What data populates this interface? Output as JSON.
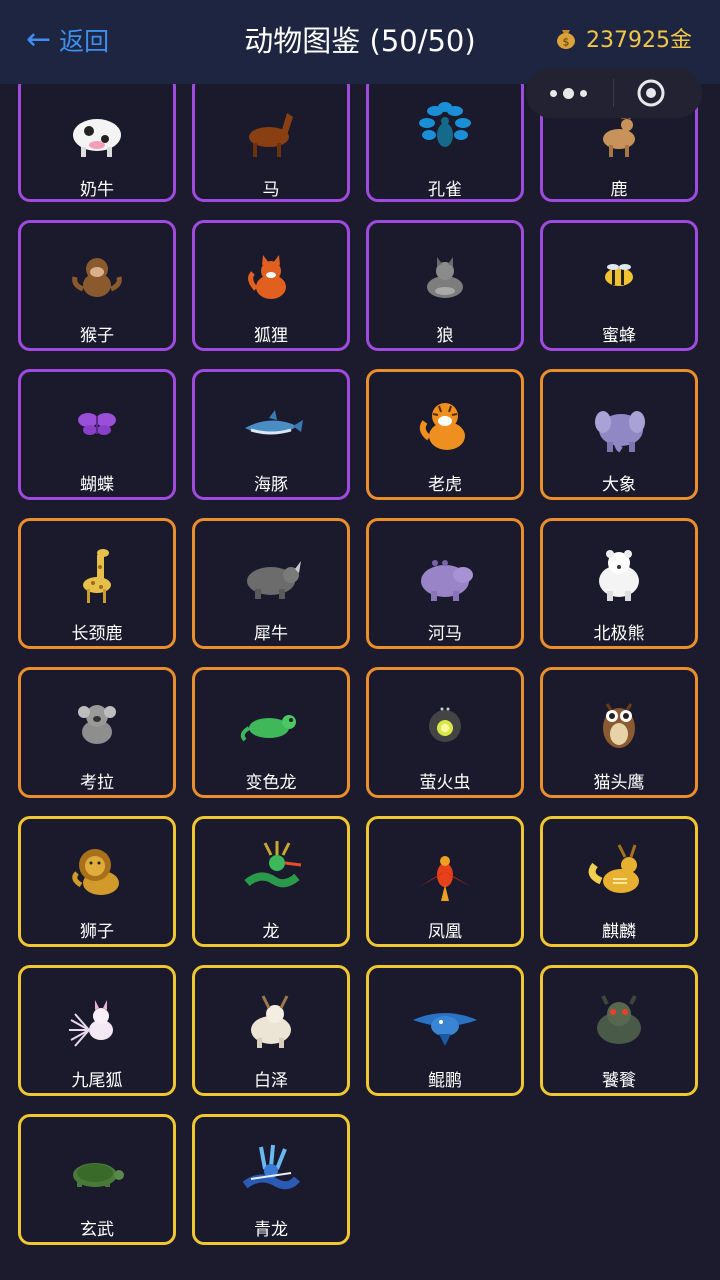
{
  "header": {
    "back_label": "返回",
    "title": "动物图鉴 (50/50)",
    "gold": "237925金"
  },
  "icons": {
    "back": "arrow-left-icon",
    "coin": "money-bag-icon",
    "more": "more-dots-icon",
    "close": "target-circle-icon"
  },
  "colors": {
    "rarity_common": "#a04be0",
    "rarity_rare": "#ea8f2c",
    "rarity_legendary": "#f0c730",
    "back": "#3e8ef0",
    "gold": "#f3c64a"
  },
  "animals": [
    {
      "name": "奶牛",
      "rarity": "purple",
      "icon": "cow-icon"
    },
    {
      "name": "马",
      "rarity": "purple",
      "icon": "horse-icon"
    },
    {
      "name": "孔雀",
      "rarity": "purple",
      "icon": "peacock-icon"
    },
    {
      "name": "鹿",
      "rarity": "purple",
      "icon": "deer-icon"
    },
    {
      "name": "猴子",
      "rarity": "purple",
      "icon": "monkey-icon"
    },
    {
      "name": "狐狸",
      "rarity": "purple",
      "icon": "fox-icon"
    },
    {
      "name": "狼",
      "rarity": "purple",
      "icon": "wolf-icon"
    },
    {
      "name": "蜜蜂",
      "rarity": "purple",
      "icon": "bee-icon"
    },
    {
      "name": "蝴蝶",
      "rarity": "purple",
      "icon": "butterfly-icon"
    },
    {
      "name": "海豚",
      "rarity": "purple",
      "icon": "dolphin-icon"
    },
    {
      "name": "老虎",
      "rarity": "orange",
      "icon": "tiger-icon"
    },
    {
      "name": "大象",
      "rarity": "orange",
      "icon": "elephant-icon"
    },
    {
      "name": "长颈鹿",
      "rarity": "orange",
      "icon": "giraffe-icon"
    },
    {
      "name": "犀牛",
      "rarity": "orange",
      "icon": "rhino-icon"
    },
    {
      "name": "河马",
      "rarity": "orange",
      "icon": "hippo-icon"
    },
    {
      "name": "北极熊",
      "rarity": "orange",
      "icon": "polar-bear-icon"
    },
    {
      "name": "考拉",
      "rarity": "orange",
      "icon": "koala-icon"
    },
    {
      "name": "变色龙",
      "rarity": "orange",
      "icon": "chameleon-icon"
    },
    {
      "name": "萤火虫",
      "rarity": "orange",
      "icon": "firefly-icon"
    },
    {
      "name": "猫头鹰",
      "rarity": "orange",
      "icon": "owl-icon"
    },
    {
      "name": "狮子",
      "rarity": "gold",
      "icon": "lion-icon"
    },
    {
      "name": "龙",
      "rarity": "gold",
      "icon": "dragon-icon"
    },
    {
      "name": "凤凰",
      "rarity": "gold",
      "icon": "phoenix-icon"
    },
    {
      "name": "麒麟",
      "rarity": "gold",
      "icon": "qilin-icon"
    },
    {
      "name": "九尾狐",
      "rarity": "gold",
      "icon": "nine-tailed-fox-icon"
    },
    {
      "name": "白泽",
      "rarity": "gold",
      "icon": "baize-icon"
    },
    {
      "name": "鲲鹏",
      "rarity": "gold",
      "icon": "kunpeng-icon"
    },
    {
      "name": "饕餮",
      "rarity": "gold",
      "icon": "taotie-icon"
    },
    {
      "name": "玄武",
      "rarity": "gold",
      "icon": "black-tortoise-icon"
    },
    {
      "name": "青龙",
      "rarity": "gold",
      "icon": "azure-dragon-icon"
    }
  ]
}
